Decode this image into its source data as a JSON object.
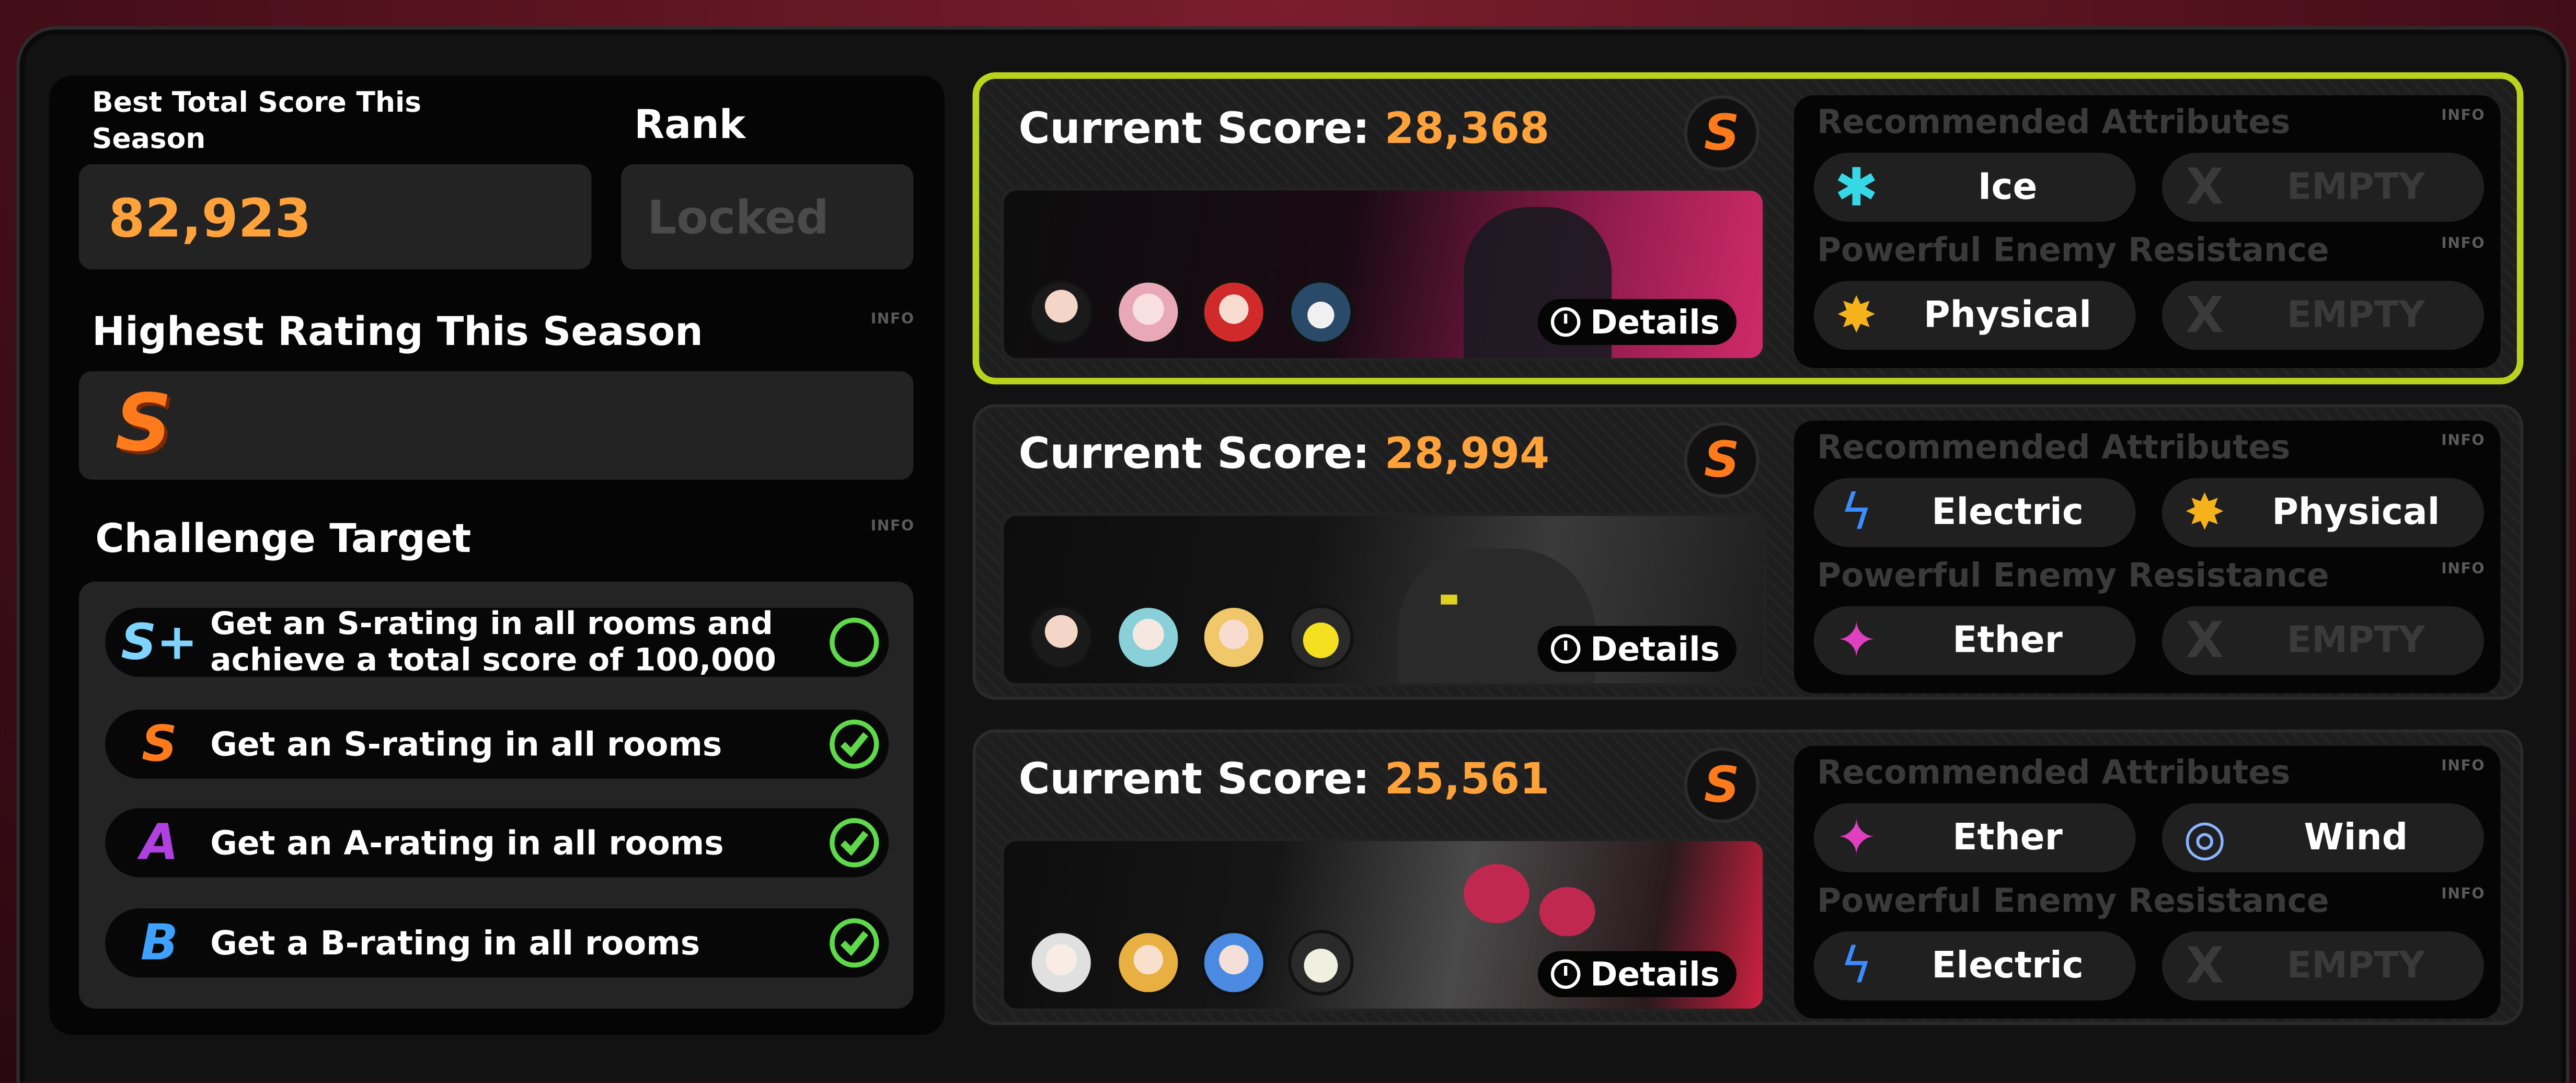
{
  "left_panel": {
    "best_total_label": "Best Total Score This Season",
    "best_total_value": "82,923",
    "rank_label": "Rank",
    "rank_value": "Locked",
    "highest_rating_label": "Highest Rating This Season",
    "highest_rating_value": "S",
    "info_label": "INFO",
    "challenge_label": "Challenge Target",
    "targets": [
      {
        "icon": "S+",
        "text_line1": "Get an S-rating in all rooms and",
        "text_line2": "achieve a total score of 100,000",
        "completed": false
      },
      {
        "icon": "S",
        "text": "Get an S-rating in all rooms",
        "completed": true
      },
      {
        "icon": "A",
        "text": "Get an A-rating in all rooms",
        "completed": true
      },
      {
        "icon": "B",
        "text": "Get a B-rating in all rooms",
        "completed": true
      }
    ]
  },
  "rooms": [
    {
      "score_label": "Current Score:",
      "score": "28,368",
      "rating": "S",
      "details_label": "Details",
      "selected": true,
      "recommended_label": "Recommended Attributes",
      "resistance_label": "Powerful Enemy Resistance",
      "recommended": [
        {
          "name": "Ice",
          "icon": "ice-icon"
        },
        {
          "name": "EMPTY",
          "icon": "empty-x-icon"
        }
      ],
      "resistance": [
        {
          "name": "Physical",
          "icon": "physical-icon"
        },
        {
          "name": "EMPTY",
          "icon": "empty-x-icon"
        }
      ]
    },
    {
      "score_label": "Current Score:",
      "score": "28,994",
      "rating": "S",
      "details_label": "Details",
      "selected": false,
      "recommended_label": "Recommended Attributes",
      "resistance_label": "Powerful Enemy Resistance",
      "recommended": [
        {
          "name": "Electric",
          "icon": "electric-icon"
        },
        {
          "name": "Physical",
          "icon": "physical-icon"
        }
      ],
      "resistance": [
        {
          "name": "Ether",
          "icon": "ether-icon"
        },
        {
          "name": "EMPTY",
          "icon": "empty-x-icon"
        }
      ]
    },
    {
      "score_label": "Current Score:",
      "score": "25,561",
      "rating": "S",
      "details_label": "Details",
      "selected": false,
      "recommended_label": "Recommended Attributes",
      "resistance_label": "Powerful Enemy Resistance",
      "recommended": [
        {
          "name": "Ether",
          "icon": "ether-icon"
        },
        {
          "name": "Wind",
          "icon": "wind-icon"
        }
      ],
      "resistance": [
        {
          "name": "Electric",
          "icon": "electric-icon"
        },
        {
          "name": "EMPTY",
          "icon": "empty-x-icon"
        }
      ]
    }
  ],
  "colors": {
    "score_accent": "#ffa23a",
    "rating_s": "#ff7a1a",
    "selected_border": "#b9d41c",
    "check_green": "#5fd84a"
  }
}
